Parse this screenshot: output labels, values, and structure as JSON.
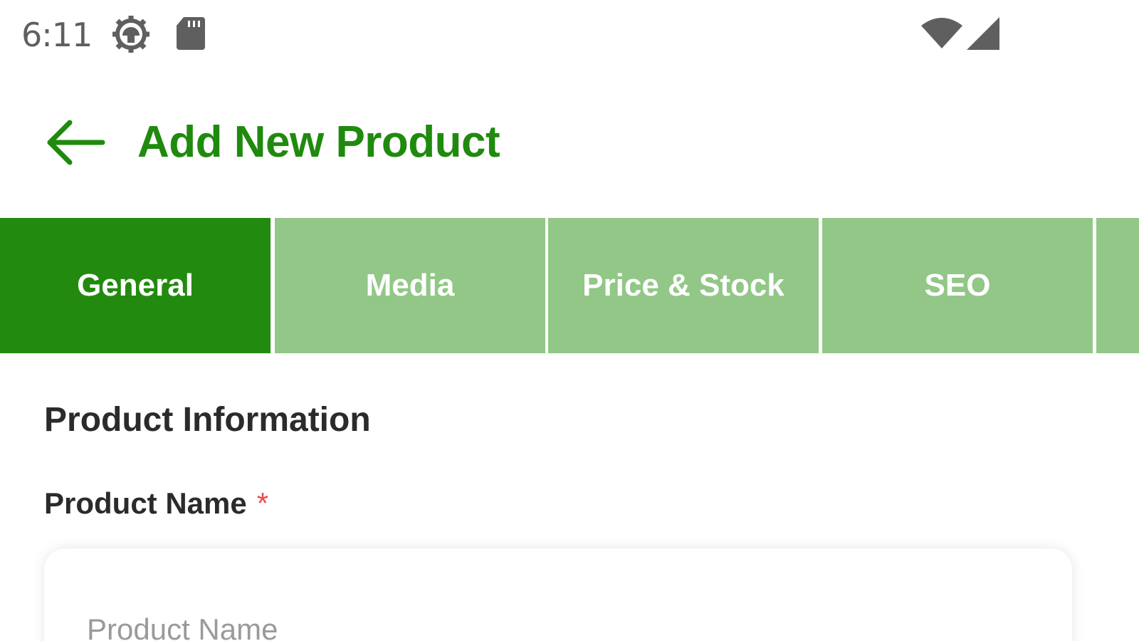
{
  "status_bar": {
    "time": "6:11",
    "icons": [
      "settings-gear-icon",
      "sd-card-icon",
      "wifi-icon",
      "cellular-signal-icon"
    ]
  },
  "app_bar": {
    "title": "Add New Product",
    "back_icon": "arrow-left-icon"
  },
  "tabs": [
    {
      "label": "General",
      "active": true
    },
    {
      "label": "Media",
      "active": false
    },
    {
      "label": "Price & Stock",
      "active": false
    },
    {
      "label": "SEO",
      "active": false
    },
    {
      "label": "",
      "active": false
    }
  ],
  "form": {
    "section_title": "Product Information",
    "fields": [
      {
        "label": "Product Name",
        "required_marker": "*",
        "placeholder": "Product Name",
        "value": ""
      }
    ]
  },
  "colors": {
    "brand_green": "#1f8a0e",
    "tab_active": "#238a10",
    "tab_inactive": "#92c787",
    "required_red": "#f04a4a",
    "status_icon_gray": "#5f5f5f"
  }
}
